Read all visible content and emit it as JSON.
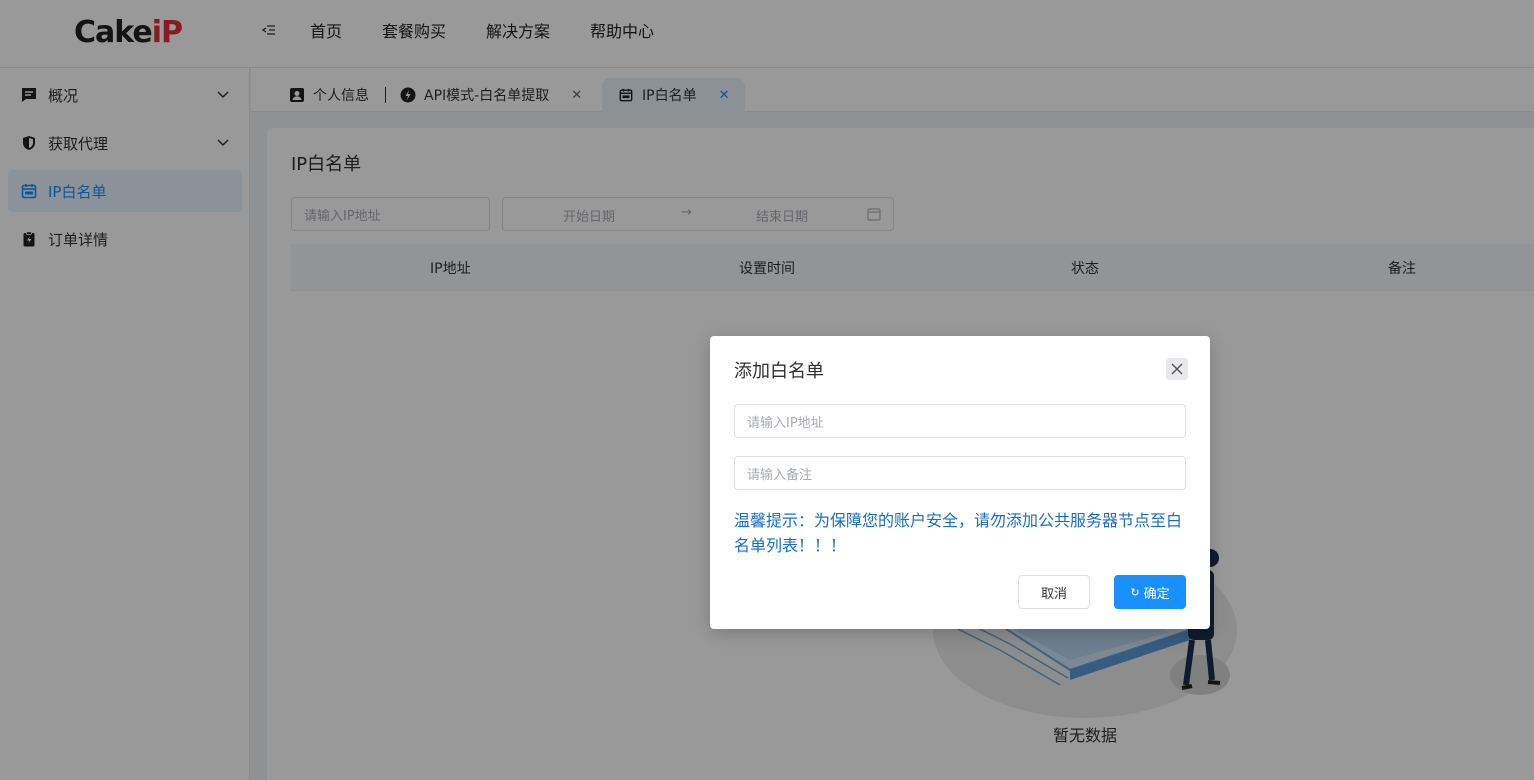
{
  "header": {
    "logo_text_main": "Cake",
    "logo_text_accent": "iP",
    "nav": [
      "首页",
      "套餐购买",
      "解决方案",
      "帮助中心"
    ]
  },
  "sidebar": {
    "items": [
      {
        "label": "概况",
        "icon": "chat-square-icon",
        "has_children": true
      },
      {
        "label": "获取代理",
        "icon": "shield-icon",
        "has_children": true
      },
      {
        "label": "IP白名单",
        "icon": "calendar-icon",
        "active": true
      },
      {
        "label": "订单详情",
        "icon": "clipboard-bolt-icon"
      }
    ]
  },
  "tabs": [
    {
      "label": "个人信息",
      "icon": "person-card-icon"
    },
    {
      "label": "API模式-白名单提取",
      "icon": "bolt-circle-icon",
      "closable": true
    },
    {
      "label": "IP白名单",
      "icon": "calendar-icon",
      "closable": true,
      "active": true
    }
  ],
  "page": {
    "title": "IP白名单",
    "ip_search_placeholder": "请输入IP地址",
    "start_date_placeholder": "开始日期",
    "date_separator": "→",
    "end_date_placeholder": "结束日期",
    "table_headers": [
      "IP地址",
      "设置时间",
      "状态",
      "备注"
    ],
    "empty_text": "暂无数据"
  },
  "dialog": {
    "title": "添加白名单",
    "ip_placeholder": "请输入IP地址",
    "note_placeholder": "请输入备注",
    "tip": "温馨提示：为保障您的账户安全，请勿添加公共服务器节点至白名单列表！！！",
    "cancel_label": "取消",
    "confirm_label": "确定"
  },
  "colors": {
    "accent": "#1890ff",
    "tip_text": "#1a6fc4",
    "logo_accent": "#e0303a"
  }
}
